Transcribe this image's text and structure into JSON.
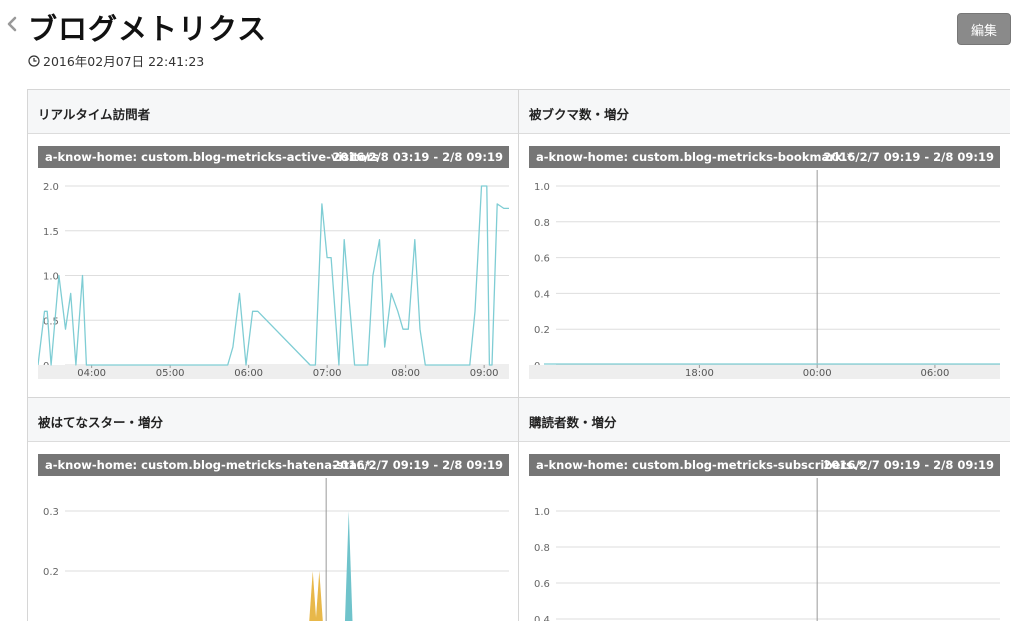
{
  "header": {
    "title": "ブログメトリクス",
    "timestamp": "2016年02月07日 22:41:23",
    "edit_label": "編集"
  },
  "panels": [
    {
      "title": "リアルタイム訪問者",
      "series_label": "a-know-home: custom.blog-metricks-active-visitors.*",
      "range": "2016/2/8 03:19 - 2/8 09:19",
      "chart_data": {
        "type": "line",
        "color": "#7fcdd4",
        "y_ticks": [
          "2.0",
          "1.5",
          "1.0",
          "0.5",
          "0"
        ],
        "ylim": [
          0,
          2
        ],
        "x_ticks": [
          "04:00",
          "05:00",
          "06:00",
          "07:00",
          "08:00",
          "09:00"
        ],
        "x": [
          "03:19",
          "03:24",
          "03:26",
          "03:29",
          "03:35",
          "03:40",
          "03:44",
          "03:48",
          "03:53",
          "03:56",
          "05:44",
          "05:48",
          "05:53",
          "05:58",
          "06:03",
          "06:07",
          "06:47",
          "06:51",
          "06:56",
          "07:00",
          "07:03",
          "07:09",
          "07:13",
          "07:21",
          "07:31",
          "07:35",
          "07:40",
          "07:44",
          "07:49",
          "07:54",
          "07:58",
          "08:02",
          "08:07",
          "08:11",
          "08:15",
          "08:19",
          "08:23",
          "08:49",
          "08:53",
          "08:58",
          "09:02",
          "09:04",
          "09:06",
          "09:10",
          "09:15",
          "09:19"
        ],
        "values": [
          0,
          0.6,
          0.6,
          0,
          1.0,
          0.4,
          0.8,
          0,
          1.0,
          0,
          0,
          0.2,
          0.8,
          0,
          0.6,
          0.6,
          0,
          0,
          1.8,
          1.2,
          1.2,
          0,
          1.4,
          0,
          0,
          1.0,
          1.4,
          0.2,
          0.8,
          0.6,
          0.4,
          0.4,
          1.4,
          0.4,
          0,
          0,
          0,
          0,
          0.6,
          2.0,
          2.0,
          0,
          0,
          1.8,
          1.75,
          1.75
        ]
      }
    },
    {
      "title": "被ブクマ数・増分",
      "series_label": "a-know-home: custom.blog-metricks-bookmark.*",
      "range": "2016/2/7 09:19 - 2/8 09:19",
      "chart_data": {
        "type": "line",
        "color": "#7fcdd4",
        "y_ticks": [
          "1.0",
          "0.8",
          "0.6",
          "0.4",
          "0.2",
          "0"
        ],
        "ylim": [
          0,
          1
        ],
        "x_ticks": [
          "18:00",
          "00:00",
          "06:00"
        ],
        "values": [
          0,
          0
        ]
      }
    },
    {
      "title": "被はてなスター・増分",
      "series_label": "a-know-home: custom.blog-metricks-hatena-star.*",
      "range": "2016/2/7 09:19 - 2/8 09:19",
      "chart_data": {
        "type": "area",
        "y_ticks": [
          "0.3",
          "0.2",
          "0.1"
        ],
        "ylim": [
          0,
          0.3
        ],
        "series": [
          {
            "color": "#e8b84a",
            "x": [
              "23:19",
              "23:39"
            ],
            "values": [
              0.2,
              0.2
            ]
          },
          {
            "color": "#6fc3cb",
            "x": [
              "01:09"
            ],
            "values": [
              0.3
            ]
          }
        ]
      }
    },
    {
      "title": "購読者数・増分",
      "series_label": "a-know-home: custom.blog-metricks-subscribers.*",
      "range": "2016/2/7 09:19 - 2/8 09:19",
      "chart_data": {
        "type": "line",
        "color": "#7fcdd4",
        "y_ticks": [
          "1.0",
          "0.8",
          "0.6",
          "0.4"
        ],
        "ylim": [
          0,
          1
        ],
        "values": []
      }
    }
  ]
}
